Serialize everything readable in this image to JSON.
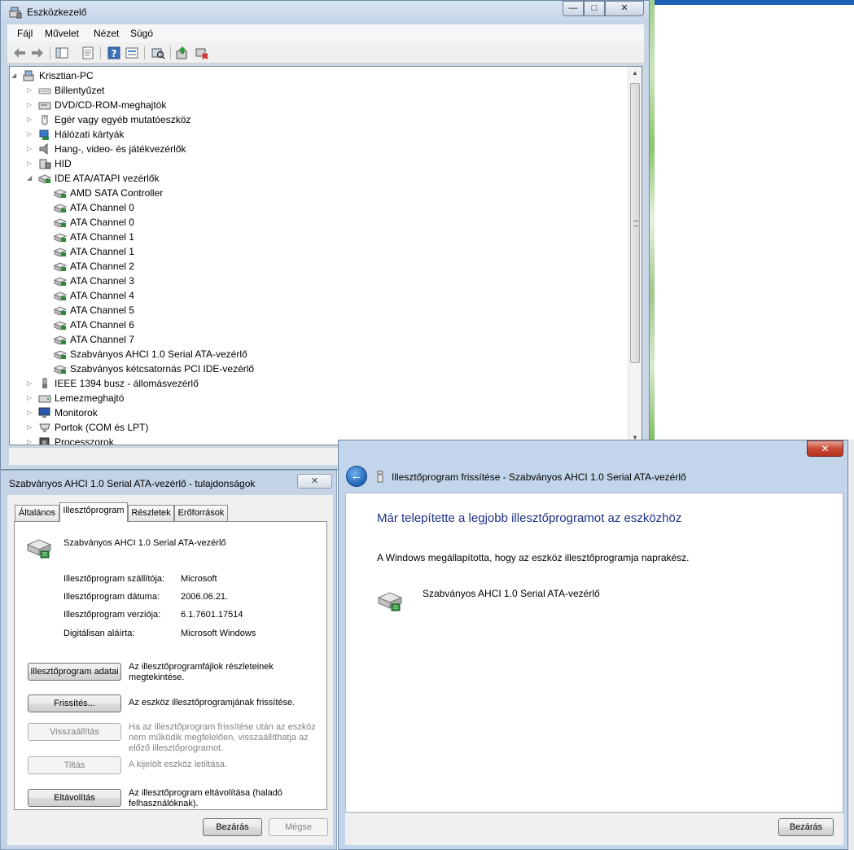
{
  "device_manager": {
    "title": "Eszközkezelő",
    "caption": {
      "minimize": "—",
      "maximize": "□",
      "close": "✕"
    },
    "menu": [
      "Fájl",
      "Művelet",
      "Nézet",
      "Súgó"
    ],
    "toolbar_icons": [
      "back-icon",
      "forward-icon",
      "show-hide-tree-icon",
      "properties-icon",
      "help-icon",
      "view-icon",
      "scan-hardware-icon",
      "update-driver-icon",
      "uninstall-icon"
    ],
    "tree": [
      {
        "level": 0,
        "expander": "◢",
        "label": "Krisztian-PC",
        "icon": "computer-icon"
      },
      {
        "level": 1,
        "expander": "▷",
        "label": "Billentyűzet",
        "icon": "keyboard-icon"
      },
      {
        "level": 1,
        "expander": "▷",
        "label": "DVD/CD-ROM-meghajtók",
        "icon": "optical-drive-icon"
      },
      {
        "level": 1,
        "expander": "▷",
        "label": "Egér vagy egyéb mutatóeszköz",
        "icon": "mouse-icon"
      },
      {
        "level": 1,
        "expander": "▷",
        "label": "Hálózati kártyák",
        "icon": "network-adapter-icon"
      },
      {
        "level": 1,
        "expander": "▷",
        "label": "Hang-, video- és játékvezérlők",
        "icon": "speaker-icon"
      },
      {
        "level": 1,
        "expander": "▷",
        "label": "HID",
        "icon": "hid-icon"
      },
      {
        "level": 1,
        "expander": "◢",
        "label": "IDE ATA/ATAPI vezérlők",
        "icon": "controller-icon"
      },
      {
        "level": 2,
        "expander": "",
        "label": "AMD SATA Controller",
        "icon": "controller-icon"
      },
      {
        "level": 2,
        "expander": "",
        "label": "ATA Channel 0",
        "icon": "controller-icon"
      },
      {
        "level": 2,
        "expander": "",
        "label": "ATA Channel 0",
        "icon": "controller-icon"
      },
      {
        "level": 2,
        "expander": "",
        "label": "ATA Channel 1",
        "icon": "controller-icon"
      },
      {
        "level": 2,
        "expander": "",
        "label": "ATA Channel 1",
        "icon": "controller-icon"
      },
      {
        "level": 2,
        "expander": "",
        "label": "ATA Channel 2",
        "icon": "controller-icon"
      },
      {
        "level": 2,
        "expander": "",
        "label": "ATA Channel 3",
        "icon": "controller-icon"
      },
      {
        "level": 2,
        "expander": "",
        "label": "ATA Channel 4",
        "icon": "controller-icon"
      },
      {
        "level": 2,
        "expander": "",
        "label": "ATA Channel 5",
        "icon": "controller-icon"
      },
      {
        "level": 2,
        "expander": "",
        "label": "ATA Channel 6",
        "icon": "controller-icon"
      },
      {
        "level": 2,
        "expander": "",
        "label": "ATA Channel 7",
        "icon": "controller-icon"
      },
      {
        "level": 2,
        "expander": "",
        "label": "Szabványos AHCI 1.0 Serial ATA-vezérlő",
        "icon": "controller-icon"
      },
      {
        "level": 2,
        "expander": "",
        "label": "Szabványos kétcsatornás PCI IDE-vezérlő",
        "icon": "controller-icon"
      },
      {
        "level": 1,
        "expander": "▷",
        "label": "IEEE 1394 busz - állomásvezérlő",
        "icon": "firewire-icon"
      },
      {
        "level": 1,
        "expander": "▷",
        "label": "Lemezmeghajtó",
        "icon": "disk-drive-icon"
      },
      {
        "level": 1,
        "expander": "▷",
        "label": "Monitorok",
        "icon": "monitor-icon"
      },
      {
        "level": 1,
        "expander": "▷",
        "label": "Portok (COM és LPT)",
        "icon": "port-icon"
      },
      {
        "level": 1,
        "expander": "▷",
        "label": "Processzorok",
        "icon": "processor-icon"
      }
    ],
    "scroll": {
      "up": "▲",
      "down": "▼"
    }
  },
  "properties": {
    "title": "Szabványos AHCI 1.0 Serial ATA-vezérlő - tulajdonságok",
    "close_glyph": "✕",
    "tabs": [
      "Általános",
      "Illesztőprogram",
      "Részletek",
      "Erőforrások"
    ],
    "active_tab": 1,
    "device_name": "Szabványos AHCI 1.0 Serial ATA-vezérlő",
    "fields": [
      {
        "label": "Illesztőprogram szállítója:",
        "value": "Microsoft"
      },
      {
        "label": "Illesztőprogram dátuma:",
        "value": "2006.06.21."
      },
      {
        "label": "Illesztőprogram verziója:",
        "value": "6.1.7601.17514"
      },
      {
        "label": "Digitálisan aláírta:",
        "value": "Microsoft Windows"
      }
    ],
    "actions": [
      {
        "button": "Illesztőprogram adatai",
        "desc": [
          "Az illesztőprogramfájlok részleteinek",
          "megtekintése."
        ],
        "enabled": true
      },
      {
        "button": "Frissítés...",
        "desc": [
          "Az eszköz illesztőprogramjának frissítése."
        ],
        "enabled": true
      },
      {
        "button": "Visszaállítás",
        "desc": [
          "Ha az illesztőprogram frissítése után az eszköz",
          "nem működik megfelelően, visszaállíthatja az",
          "előző illesztőprogramot."
        ],
        "enabled": false
      },
      {
        "button": "Tiltás",
        "desc": [
          "A kijelölt eszköz letiltása."
        ],
        "enabled": false
      },
      {
        "button": "Eltávolítás",
        "desc": [
          "Az illesztőprogram eltávolítása (haladó",
          "felhasználóknak)."
        ],
        "enabled": true
      }
    ],
    "close_button": "Bezárás",
    "cancel_button": "Mégse"
  },
  "wizard": {
    "close_glyph": "✕",
    "back_glyph": "←",
    "title": "Illesztőprogram frissítése - Szabványos AHCI 1.0 Serial ATA-vezérlő",
    "heading": "Már telepítette a legjobb illesztőprogramot az eszközhöz",
    "message": "A Windows megállapította, hogy az eszköz illesztőprogramja naprakész.",
    "device_name": "Szabványos AHCI 1.0 Serial ATA-vezérlő",
    "close_button": "Bezárás",
    "heading_color": "#1e3287"
  },
  "colors": {
    "titlebar": "#c9d6e6",
    "accent_blue": "#1f62b7",
    "close_red": "#c74a35"
  }
}
